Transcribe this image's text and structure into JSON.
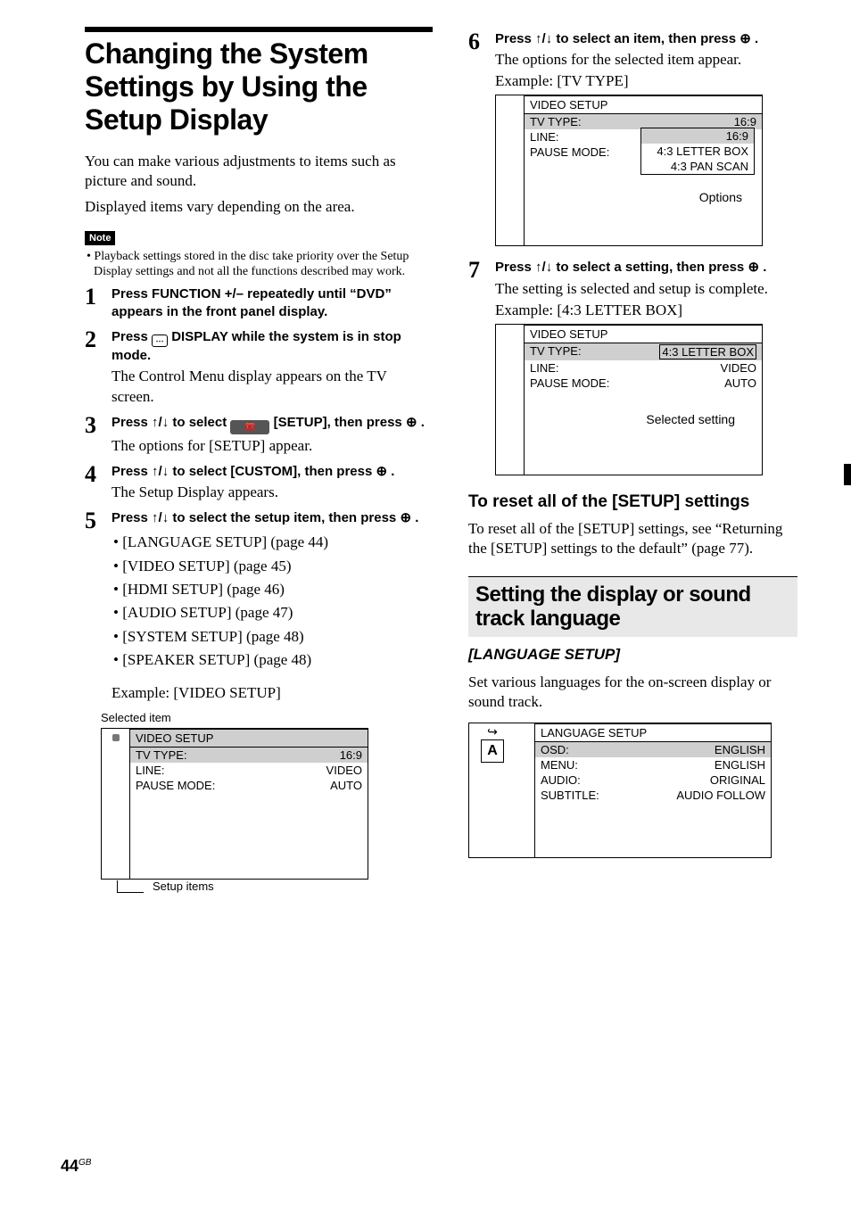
{
  "title": "Changing the System Settings by Using the Setup Display",
  "intro1": "You can make various adjustments to items such as picture and sound.",
  "intro2": "Displayed items vary depending on the area.",
  "note_label": "Note",
  "note_text": "• Playback settings stored in the disc take priority over the Setup Display settings and not all the functions described may work.",
  "steps": {
    "s1_head": "Press FUNCTION +/– repeatedly until “DVD” appears in the front panel display.",
    "s2_head_a": "Press ",
    "s2_head_b": " DISPLAY while the system is in stop mode.",
    "s2_desc": "The Control Menu display appears on the TV screen.",
    "s3_head_a": "Press ↑/↓ to select ",
    "s3_head_b": " [SETUP], then press ",
    "s3_head_c": " .",
    "s3_desc": "The options for [SETUP] appear.",
    "s4_head_a": "Press ↑/↓ to select [CUSTOM], then press ",
    "s4_head_b": " .",
    "s4_desc": "The Setup Display appears.",
    "s5_head_a": "Press ↑/↓ to select the setup item, then press ",
    "s5_head_b": " .",
    "s5_items": [
      "• [LANGUAGE SETUP] (page 44)",
      "• [VIDEO SETUP] (page 45)",
      "• [HDMI SETUP] (page 46)",
      "• [AUDIO SETUP] (page 47)",
      "• [SYSTEM SETUP] (page 48)",
      "• [SPEAKER SETUP] (page 48)"
    ],
    "s5_example": "Example: [VIDEO SETUP]",
    "s5_selected_item": "Selected item",
    "s5_setup_items": "Setup items",
    "s6_head_a": "Press ↑/↓ to select an item, then press ",
    "s6_head_b": " .",
    "s6_desc1": "The options for the selected item appear.",
    "s6_desc2": "Example: [TV TYPE]",
    "s6_options_label": "Options",
    "s7_head_a": "Press ↑/↓ to select a setting, then press ",
    "s7_head_b": " .",
    "s7_desc1": "The setting is selected and setup is complete.",
    "s7_desc2": "Example: [4:3 LETTER BOX]",
    "s7_selected_setting": "Selected setting"
  },
  "osd_video": {
    "title": "VIDEO SETUP",
    "rows": [
      {
        "k": "TV TYPE:",
        "v": "16:9"
      },
      {
        "k": "LINE:",
        "v": "VIDEO"
      },
      {
        "k": "PAUSE MODE:",
        "v": "AUTO"
      }
    ]
  },
  "osd_video_dropdown": {
    "title": "VIDEO SETUP",
    "rows": [
      {
        "k": "TV TYPE:",
        "v": "16:9"
      },
      {
        "k": "LINE:",
        "v": ""
      },
      {
        "k": "PAUSE MODE:",
        "v": ""
      }
    ],
    "options": [
      "16:9",
      "4:3 LETTER BOX",
      "4:3 PAN SCAN"
    ]
  },
  "osd_video_selected": {
    "title": "VIDEO SETUP",
    "rows": [
      {
        "k": "TV TYPE:",
        "v": "4:3 LETTER BOX"
      },
      {
        "k": "LINE:",
        "v": "VIDEO"
      },
      {
        "k": "PAUSE MODE:",
        "v": "AUTO"
      }
    ]
  },
  "reset_heading": "To reset all of the [SETUP] settings",
  "reset_body": "To reset all of the [SETUP] settings, see “Returning the [SETUP] settings to the default” (page 77).",
  "lang_bar": "Setting the display or sound track language",
  "lang_sub": "[LANGUAGE SETUP]",
  "lang_body": "Set various languages for the on-screen display or sound track.",
  "osd_lang": {
    "title": "LANGUAGE SETUP",
    "icon": "A",
    "rows": [
      {
        "k": "OSD:",
        "v": "ENGLISH"
      },
      {
        "k": "MENU:",
        "v": "ENGLISH"
      },
      {
        "k": "AUDIO:",
        "v": "ORIGINAL"
      },
      {
        "k": "SUBTITLE:",
        "v": "AUDIO FOLLOW"
      }
    ]
  },
  "page_number": "44",
  "page_suffix": "GB",
  "enter_icon": "⊕"
}
